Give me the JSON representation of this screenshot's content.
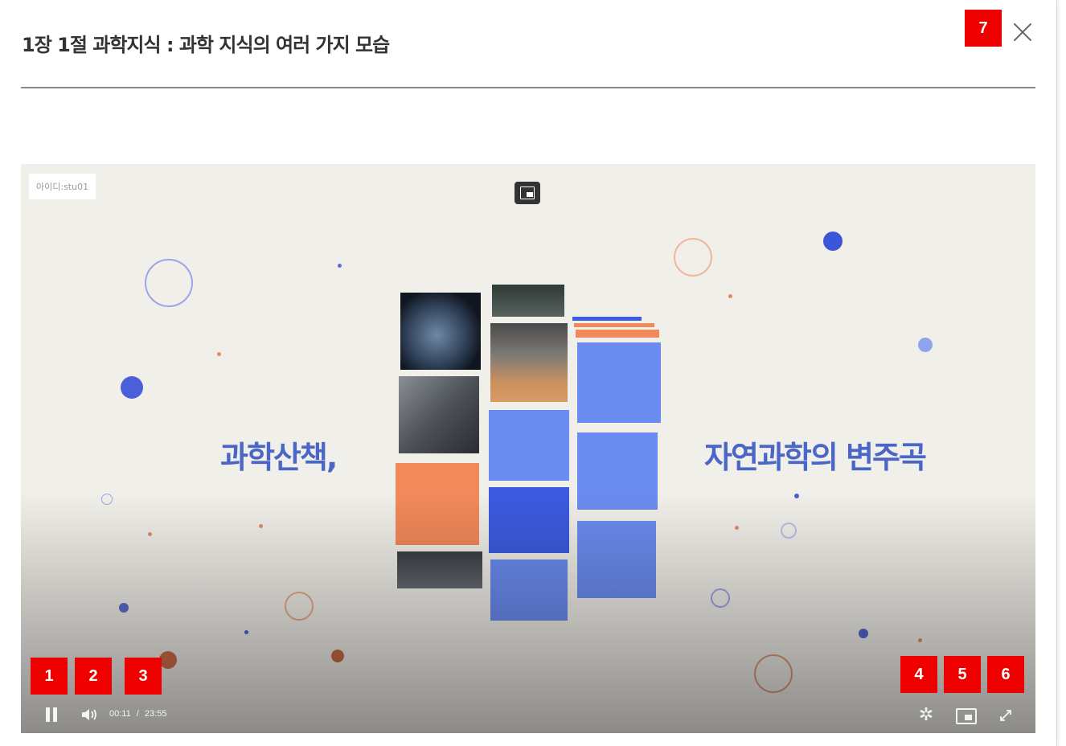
{
  "modal": {
    "title": "1장 1절 과학지식 : 과학 지식의 여러 가지 모습",
    "close_icon": "close-icon"
  },
  "player": {
    "watermark": "아이디:stu01",
    "headline_left": "과학산책,",
    "headline_right": "자연과학의 변주곡",
    "controls": {
      "current_time": "00:11",
      "separator": "/",
      "duration": "23:55",
      "icons": [
        "pause-icon",
        "volume-icon",
        "settings-gear-icon",
        "picture-in-picture-icon",
        "fullscreen-icon"
      ]
    }
  },
  "annotations": {
    "badges": [
      "1",
      "2",
      "3",
      "4",
      "5",
      "6",
      "7"
    ],
    "color": "#ee0000"
  },
  "colors": {
    "accent_blue": "#4a67c7",
    "tile_blue": "#6b8cf0",
    "tile_dark_blue": "#3d5be0",
    "tile_orange": "#f2895a",
    "video_bg": "#f1efe9"
  }
}
